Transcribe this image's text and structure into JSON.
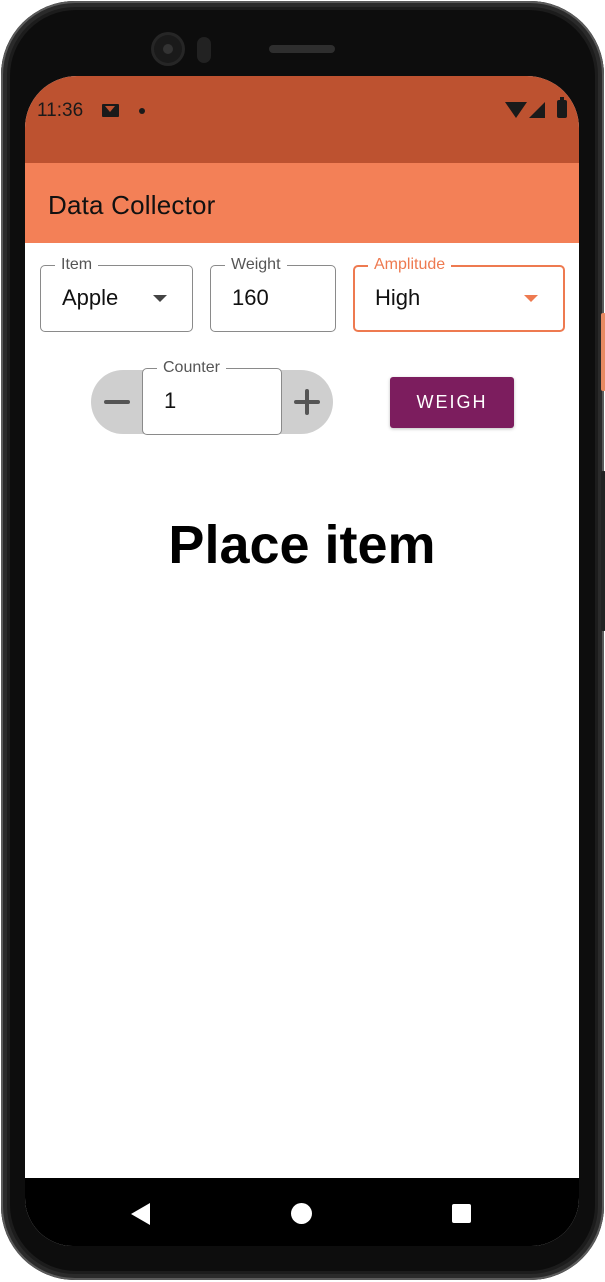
{
  "status_bar": {
    "time": "11:36",
    "icons": [
      "gmail-icon",
      "notification-dot-icon",
      "wifi-icon",
      "signal-icon",
      "battery-icon"
    ]
  },
  "app_bar": {
    "title": "Data Collector"
  },
  "form": {
    "item": {
      "label": "Item",
      "value": "Apple"
    },
    "weight": {
      "label": "Weight",
      "value": "160"
    },
    "amplitude": {
      "label": "Amplitude",
      "value": "High"
    }
  },
  "counter": {
    "label": "Counter",
    "value": "1",
    "decrement_icon": "minus-icon",
    "increment_icon": "plus-icon"
  },
  "weigh_button": {
    "label": "WEIGH"
  },
  "instruction": "Place item",
  "nav": {
    "icons": [
      "back-icon",
      "home-icon",
      "recents-icon"
    ]
  },
  "colors": {
    "status_bar": "#bd5230",
    "app_bar": "#f38057",
    "accent": "#ee7a50",
    "weigh_button": "#7c1d5e"
  }
}
